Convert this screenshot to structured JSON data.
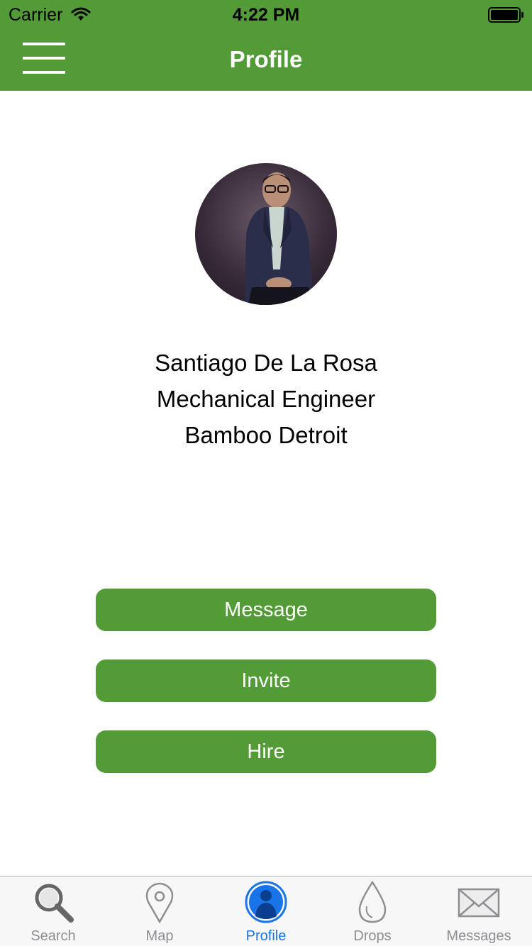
{
  "status_bar": {
    "carrier": "Carrier",
    "time": "4:22 PM"
  },
  "nav": {
    "title": "Profile"
  },
  "profile": {
    "name": "Santiago De La Rosa",
    "title": "Mechanical Engineer",
    "company": "Bamboo Detroit"
  },
  "actions": {
    "message": "Message",
    "invite": "Invite",
    "hire": "Hire"
  },
  "tabs": [
    {
      "label": "Search",
      "icon": "search-icon",
      "active": false
    },
    {
      "label": "Map",
      "icon": "map-pin-icon",
      "active": false
    },
    {
      "label": "Profile",
      "icon": "person-icon",
      "active": true
    },
    {
      "label": "Drops",
      "icon": "drop-icon",
      "active": false
    },
    {
      "label": "Messages",
      "icon": "envelope-icon",
      "active": false
    }
  ],
  "colors": {
    "brand_green": "#539b37",
    "tab_active": "#1874e8",
    "tab_inactive": "#8e8e93"
  }
}
